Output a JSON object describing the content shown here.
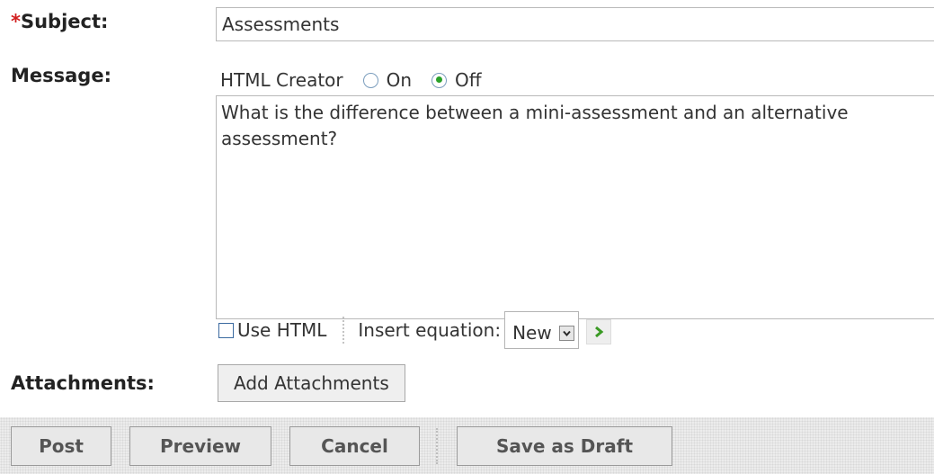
{
  "subject": {
    "required_mark": "*",
    "label": "Subject:",
    "value": "Assessments"
  },
  "message": {
    "label": "Message:",
    "html_creator": {
      "label": "HTML Creator",
      "options": [
        {
          "label": "On",
          "selected": false
        },
        {
          "label": "Off",
          "selected": true
        }
      ]
    },
    "body": "What is the difference between a mini-assessment and an alternative assessment?",
    "use_html": {
      "label": "Use HTML",
      "checked": false
    },
    "insert_equation": {
      "label": "Insert equation:",
      "selected": "New"
    }
  },
  "attachments": {
    "label": "Attachments:",
    "button": "Add Attachments"
  },
  "actions": {
    "post": "Post",
    "preview": "Preview",
    "cancel": "Cancel",
    "save_draft": "Save as Draft"
  },
  "colors": {
    "required": "#d11f1f",
    "radio_selected": "#2aa12a",
    "go_arrow": "#3a9a24"
  },
  "icons": {
    "go": "green-chevron-right-icon",
    "select_arrow": "chevron-down-icon"
  }
}
